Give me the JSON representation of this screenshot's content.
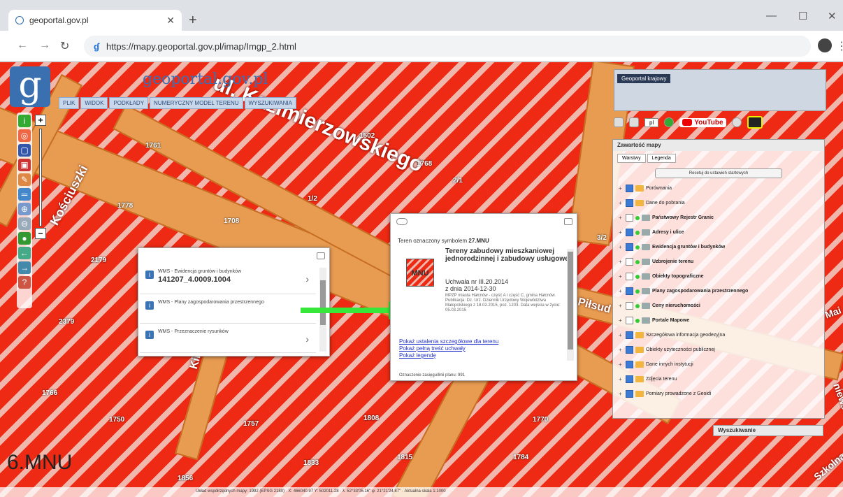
{
  "browser": {
    "tab_title": "geoportal.gov.pl",
    "url": "https://mapy.geoportal.gov.pl/imap/Imgp_2.html"
  },
  "app": {
    "brand": "geoportal.gov.pl",
    "menu": [
      "PLIK",
      "WIDOK",
      "PODKŁADY",
      "NUMERYCZNY MODEL TERENU",
      "WYSZUKIWANIA"
    ]
  },
  "map_labels": {
    "street_top": "ul. Kazimierzowskiego",
    "kosciuszki": "Kościuszki",
    "pilsud": "Piłsud",
    "kil": "Kil",
    "mnu_big": "6.MNU",
    "szkolna": "Szkolna",
    "ga": "Mai",
    "niewsk": "niews"
  },
  "parcels": [
    "1761",
    "1708",
    "1502",
    "2/1",
    "1778",
    "2179",
    "2379",
    "1766",
    "1/2",
    "1768",
    "1750",
    "1757",
    "1808",
    "1770",
    "3/2",
    "1815",
    "1833",
    "1856",
    "1784"
  ],
  "popup_left": {
    "items": [
      {
        "title": "WMS - Ewidencja gruntów i budynków",
        "value": "141207_4.0009.1004"
      },
      {
        "title": "WMS - Plany zagospodarowania przestrzennego",
        "value": ""
      },
      {
        "title": "WMS - Przeznaczenie rysunków",
        "value": ""
      }
    ]
  },
  "popup_right": {
    "header_prefix": "Teren oznaczony symbolem ",
    "symbol": "27.MNU",
    "title": "Tereny zabudowy mieszkaniowej jednorodzinnej i zabudowy usługowej",
    "symbol_label": "MNU",
    "uchwala": "Uchwała nr III.20.2014",
    "date": "z dnia 2014-12-30",
    "details": "MPZP miasta Hałcnów - część A i część C, gmina Hałcnów. Publikacja: Dz. Urz. Dziennik Urzędowy Województwa Małopolskiego z 18.02.2015, poz. 1203. Data wejścia w życie: 05.03.2015",
    "links": [
      "Pokaż ustalenia szczegółowe dla terenu",
      "Pokaż pełną treść uchwały",
      "Pokaż legendę"
    ],
    "footer": "Oznaczenie zasięgu/linii planu: 991"
  },
  "minimap": {
    "label": "Geoportal krajowy"
  },
  "toolbar": {
    "lang": "pl",
    "youtube": "YouTube"
  },
  "layers": {
    "title": "Zawartość mapy",
    "tabs": [
      "Warstwy",
      "Legenda"
    ],
    "reset": "Resetuj do ustawień startowych",
    "rows": [
      {
        "label": "Porównania",
        "checked": true,
        "bold": false
      },
      {
        "label": "Dane do pobrania",
        "checked": true,
        "bold": false
      },
      {
        "label": "Państwowy Rejestr Granic",
        "checked": false,
        "bold": true
      },
      {
        "label": "Adresy i ulice",
        "checked": true,
        "bold": true
      },
      {
        "label": "Ewidencja gruntów i budynków",
        "checked": true,
        "bold": true
      },
      {
        "label": "Uzbrojenie terenu",
        "checked": false,
        "bold": true
      },
      {
        "label": "Obiekty topograficzne",
        "checked": false,
        "bold": true
      },
      {
        "label": "Plany zagospodarowania przestrzennego",
        "checked": true,
        "bold": true
      },
      {
        "label": "Ceny nieruchomości",
        "checked": false,
        "bold": true
      },
      {
        "label": "Portale Mapowe",
        "checked": false,
        "bold": true
      },
      {
        "label": "Szczegółowa informacja geodezyjna",
        "checked": true,
        "bold": false
      },
      {
        "label": "Obiekty użyteczności publicznej",
        "checked": true,
        "bold": false
      },
      {
        "label": "Dane innych instytucji",
        "checked": true,
        "bold": false
      },
      {
        "label": "Zdjęcia terenu",
        "checked": true,
        "bold": false
      },
      {
        "label": "Pomiary prowadzone z Geoidi",
        "checked": true,
        "bold": false
      }
    ]
  },
  "search": {
    "label": "Wyszukiwanie"
  },
  "status": {
    "text": "Układ współrzędnych mapy: 1992 (EPSG 2180) · X: 466040.97 Y: 502011.28 · λ: 52°33'05.16\" φ: 21°21'24.87\" · Aktualna skala 1:1000"
  }
}
